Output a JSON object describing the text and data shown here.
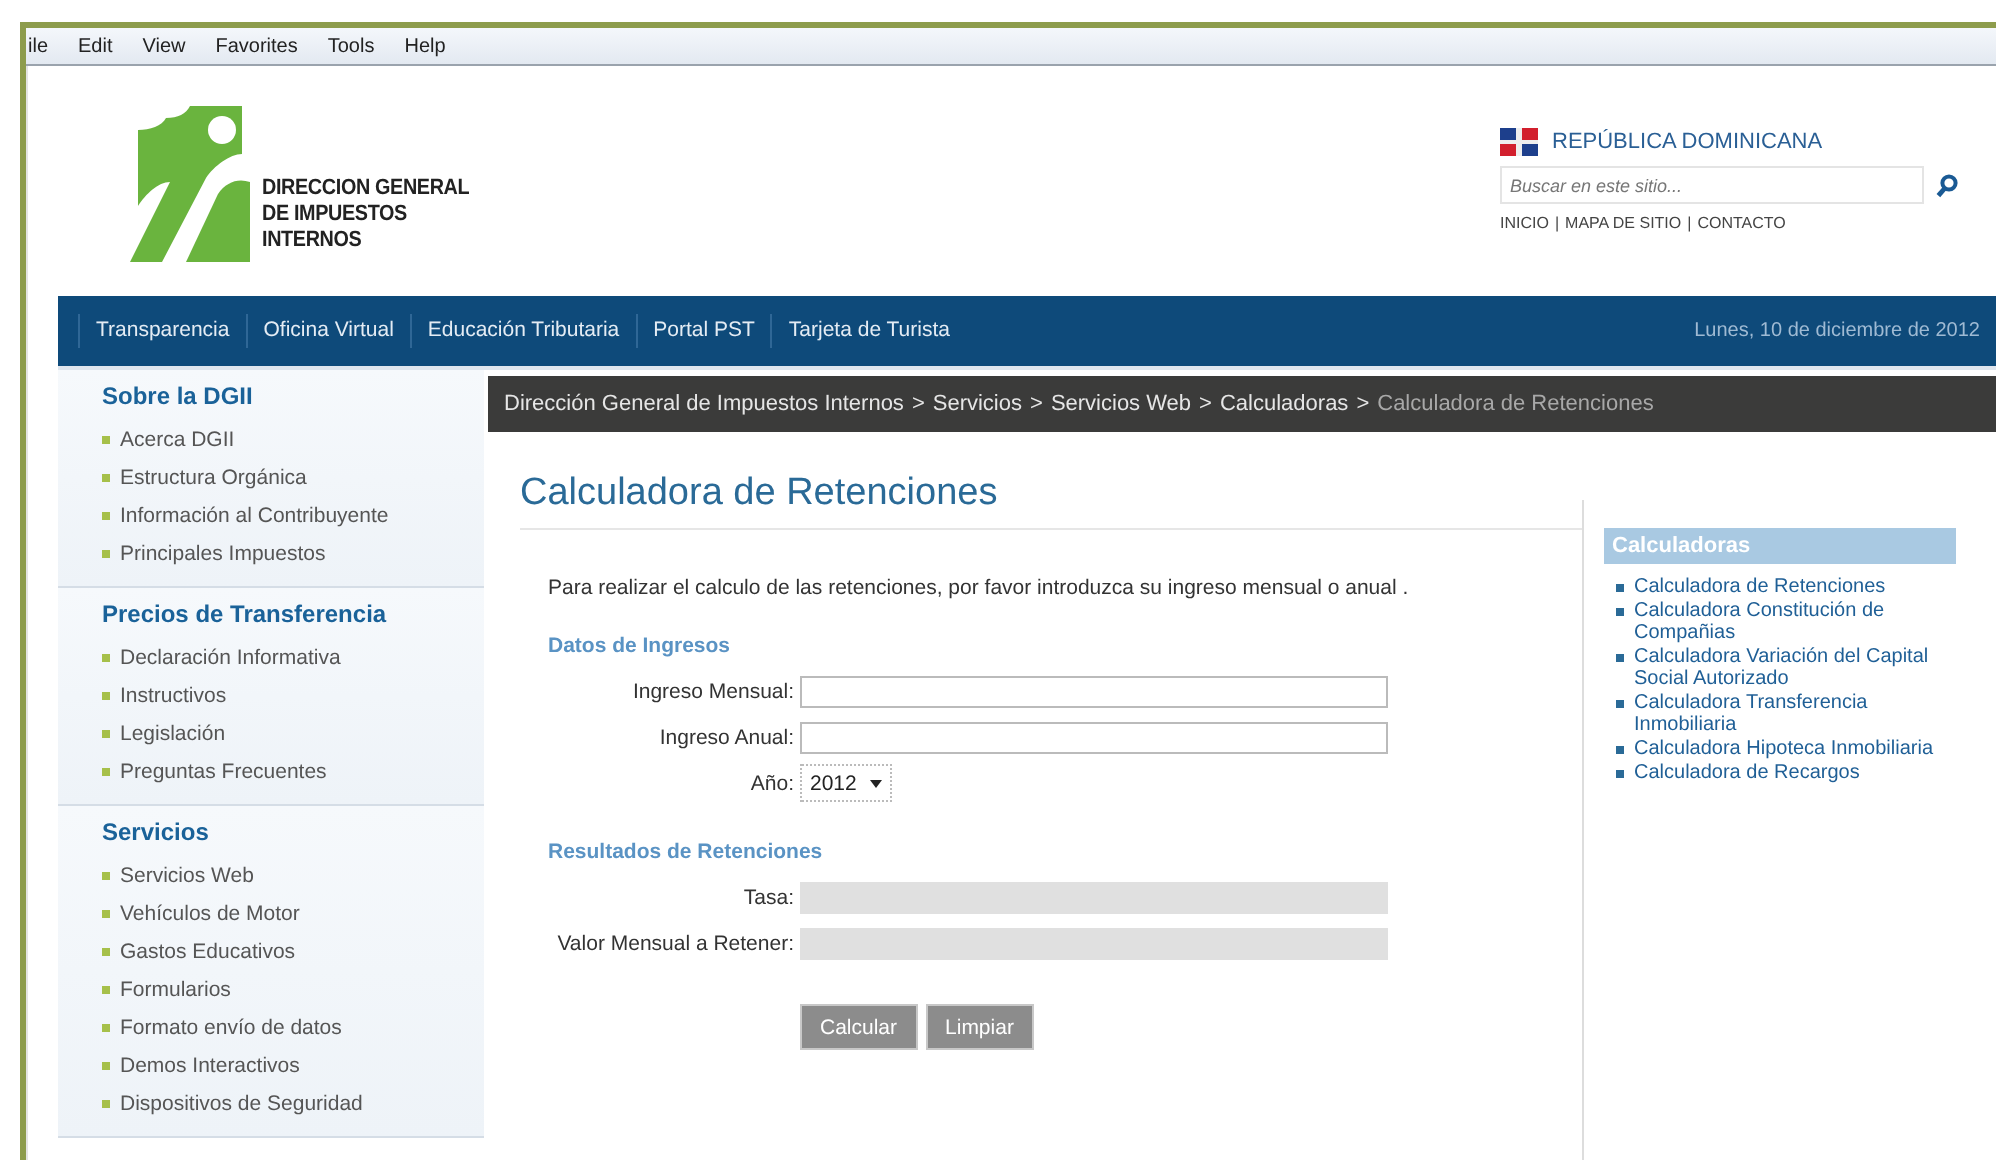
{
  "browser_menu": [
    "ile",
    "Edit",
    "View",
    "Favorites",
    "Tools",
    "Help"
  ],
  "header": {
    "logo_lines": [
      "DIRECCION GENERAL",
      "DE IMPUESTOS",
      "INTERNOS"
    ],
    "country": "REPÚBLICA DOMINICANA",
    "search": {
      "placeholder": "Buscar en este sitio..."
    },
    "links": [
      "INICIO",
      "MAPA DE SITIO",
      "CONTACTO"
    ],
    "link_separator": "|"
  },
  "nav": {
    "items": [
      "Transparencia",
      "Oficina Virtual",
      "Educación Tributaria",
      "Portal PST",
      "Tarjeta de Turista"
    ],
    "date": "Lunes, 10 de diciembre de 2012"
  },
  "sidebar": {
    "sections": [
      {
        "title": "Sobre la DGII",
        "items": [
          "Acerca DGII",
          "Estructura Orgánica",
          "Información al Contribuyente",
          "Principales Impuestos"
        ]
      },
      {
        "title": "Precios de Transferencia",
        "items": [
          "Declaración Informativa",
          "Instructivos",
          "Legislación",
          "Preguntas Frecuentes"
        ]
      },
      {
        "title": "Servicios",
        "items": [
          "Servicios Web",
          "Vehículos de Motor",
          "Gastos Educativos",
          "Formularios",
          "Formato envío de datos",
          "Demos Interactivos",
          "Dispositivos de Seguridad"
        ]
      }
    ]
  },
  "breadcrumb": {
    "separator": ">",
    "items": [
      {
        "label": "Dirección General de Impuestos Internos",
        "current": false
      },
      {
        "label": "Servicios",
        "current": false
      },
      {
        "label": "Servicios Web",
        "current": false
      },
      {
        "label": "Calculadoras",
        "current": false
      },
      {
        "label": "Calculadora de Retenciones",
        "current": true
      }
    ]
  },
  "page_title": "Calculadora de Retenciones",
  "form": {
    "intro": "Para realizar el calculo de las retenciones, por favor introduzca su ingreso mensual o anual .",
    "sections": [
      {
        "heading": "Datos de Ingresos",
        "fields": [
          {
            "label": "Ingreso Mensual:",
            "kind": "text"
          },
          {
            "label": "Ingreso Anual:",
            "kind": "text"
          },
          {
            "label": "Año:",
            "kind": "select",
            "value": "2012"
          }
        ]
      },
      {
        "heading": "Resultados de Retenciones",
        "fields": [
          {
            "label": "Tasa:",
            "kind": "output"
          },
          {
            "label": "Valor Mensual a Retener:",
            "kind": "output"
          }
        ]
      }
    ],
    "buttons": [
      {
        "label": "Calcular",
        "disabled": true
      },
      {
        "label": "Limpiar",
        "disabled": true
      }
    ]
  },
  "related": {
    "title": "Calculadoras",
    "items": [
      "Calculadora de Retenciones",
      "Calculadora Constitución de Compañias",
      "Calculadora Variación del Capital Social Autorizado",
      "Calculadora Transferencia Inmobiliaria",
      "Calculadora Hipoteca Inmobiliaria",
      "Calculadora de Recargos"
    ]
  }
}
